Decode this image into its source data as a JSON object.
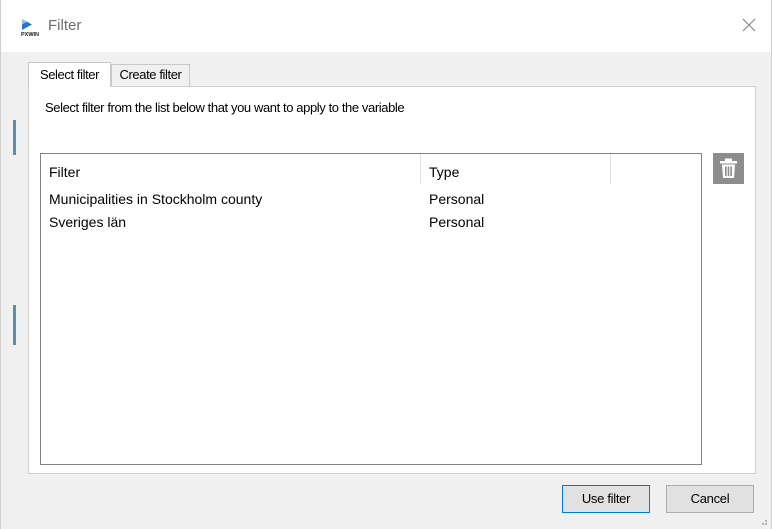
{
  "window": {
    "title": "Filter",
    "close_icon": "close-icon",
    "app_icon": "pxwin-logo-icon"
  },
  "tabs": [
    {
      "label": "Select filter",
      "active": true
    },
    {
      "label": "Create filter",
      "active": false
    }
  ],
  "panel": {
    "instruction": "Select filter from the list below that you want to apply to the variable"
  },
  "filter_list": {
    "columns": [
      "Filter",
      "Type"
    ],
    "rows": [
      {
        "filter": "Municipalities in Stockholm county",
        "type": "Personal"
      },
      {
        "filter": "Sveriges län",
        "type": "Personal"
      }
    ],
    "delete_icon": "trash-icon"
  },
  "buttons": {
    "use_filter": "Use filter",
    "cancel": "Cancel"
  },
  "colors": {
    "background": "#f0f0f0",
    "panel": "#ffffff",
    "accent": "#0078d7",
    "icon_button": "#8d8d8d"
  }
}
